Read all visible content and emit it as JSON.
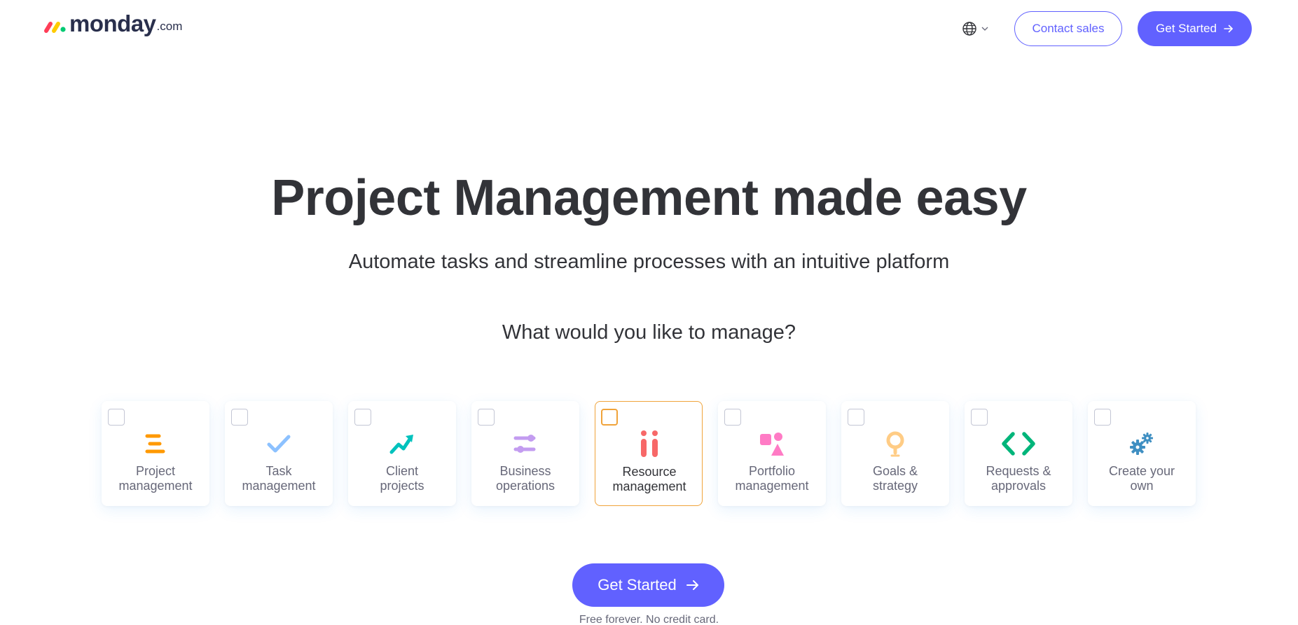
{
  "header": {
    "logo_word": "monday",
    "logo_suffix": ".com",
    "language_icon": "globe-icon",
    "contact_label": "Contact sales",
    "get_started_label": "Get Started"
  },
  "hero": {
    "title": "Project Management made easy",
    "subtitle": "Automate tasks and streamline processes with an intuitive platform",
    "question": "What would you like to manage?"
  },
  "options": [
    {
      "line1": "Project",
      "line2": "management",
      "icon": "project-management-icon",
      "color": "#ff9900",
      "selected": false
    },
    {
      "line1": "Task",
      "line2": "management",
      "icon": "check-icon",
      "color": "#8cc1ff",
      "selected": false
    },
    {
      "line1": "Client",
      "line2": "projects",
      "icon": "trend-arrow-icon",
      "color": "#00c2bd",
      "selected": false
    },
    {
      "line1": "Business",
      "line2": "operations",
      "icon": "sliders-icon",
      "color": "#c39cf0",
      "selected": false
    },
    {
      "line1": "Resource",
      "line2": "management",
      "icon": "people-icon",
      "color": "#f76868",
      "selected": true
    },
    {
      "line1": "Portfolio",
      "line2": "management",
      "icon": "shapes-icon",
      "color": "#ff7bc5",
      "selected": false
    },
    {
      "line1": "Goals &",
      "line2": "strategy",
      "icon": "lightbulb-icon",
      "color": "#ffcc85",
      "selected": false
    },
    {
      "line1": "Requests &",
      "line2": "approvals",
      "icon": "code-brackets-icon",
      "color": "#00b57a",
      "selected": false
    },
    {
      "line1": "Create your",
      "line2": "own",
      "icon": "gears-icon",
      "color": "#3f8fc2",
      "selected": false
    }
  ],
  "cta": {
    "label": "Get Started",
    "note": "Free forever. No credit card."
  },
  "colors": {
    "accent": "#6161ff",
    "selected_border": "#f0a33a",
    "text": "#323338"
  }
}
